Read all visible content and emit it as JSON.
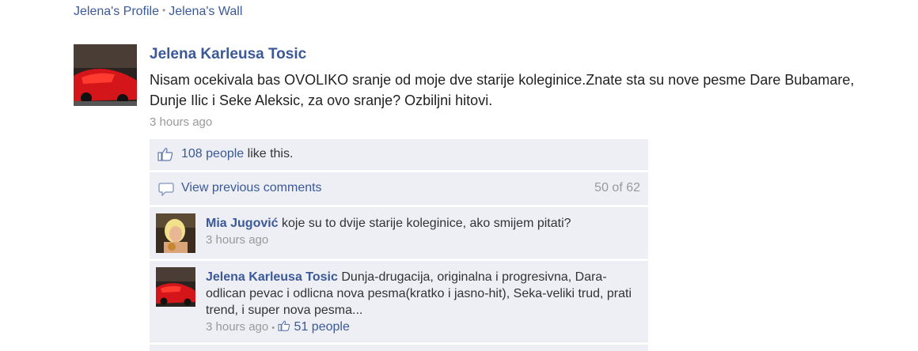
{
  "breadcrumb": {
    "profile": "Jelena's Profile",
    "wall": "Jelena's Wall"
  },
  "post": {
    "author": "Jelena Karleusa Tosic",
    "text": "Nisam ocekivala bas OVOLIKO sranje od moje dve starije koleginice.Znate sta su nove pesme Dare Bubamare, Dunje Ilic i Seke Aleksic, za ovo sranje? Ozbiljni hitovi.",
    "time": "3 hours ago"
  },
  "likes": {
    "people_link": "108 people",
    "suffix": " like this."
  },
  "comments_header": {
    "view_previous": "View previous comments",
    "count": "50 of 62"
  },
  "comments": [
    {
      "author": "Mia Jugović",
      "text": "koje su to dvije starije koleginice, ako smijem pitati?",
      "time": "3 hours ago"
    },
    {
      "author": "Jelena Karleusa Tosic",
      "text": "Dunja-drugacija, originalna i progresivna, Dara-odlican pevac i odlicna nova pesma(kratko i jasno-hit), Seka-veliki trud, prati trend, i super nova pesma...",
      "time": "3 hours ago",
      "likes": "51 people"
    }
  ],
  "colors": {
    "link": "#3b5998",
    "ufi_bg": "#edeff4",
    "meta": "#999999"
  },
  "icons": [
    "thumbs-up-icon",
    "comment-bubble-icon"
  ]
}
